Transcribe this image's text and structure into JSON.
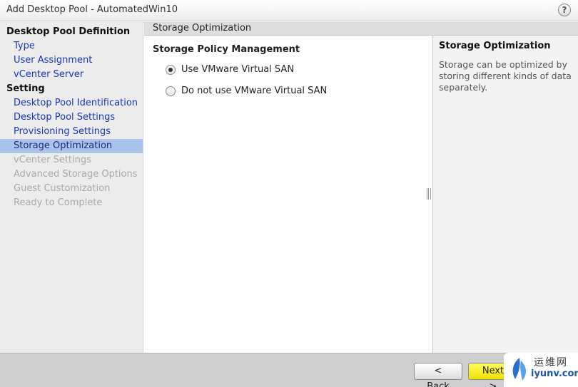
{
  "window": {
    "title": "Add Desktop Pool - AutomatedWin10",
    "help_label": "?"
  },
  "nav": {
    "definition_group": "Desktop Pool Definition",
    "definition_items": [
      {
        "label": "Type",
        "state": "link"
      },
      {
        "label": "User Assignment",
        "state": "link"
      },
      {
        "label": "vCenter Server",
        "state": "link"
      }
    ],
    "setting_group": "Setting",
    "setting_items": [
      {
        "label": "Desktop Pool Identification",
        "state": "link"
      },
      {
        "label": "Desktop Pool Settings",
        "state": "link"
      },
      {
        "label": "Provisioning Settings",
        "state": "link"
      },
      {
        "label": "Storage Optimization",
        "state": "active"
      },
      {
        "label": "vCenter Settings",
        "state": "disabled"
      },
      {
        "label": "Advanced Storage Options",
        "state": "disabled"
      },
      {
        "label": "Guest Customization",
        "state": "disabled"
      },
      {
        "label": "Ready to Complete",
        "state": "disabled"
      }
    ]
  },
  "main": {
    "header": "Storage Optimization",
    "section_title": "Storage Policy Management",
    "options": [
      {
        "label": "Use VMware Virtual SAN",
        "checked": true
      },
      {
        "label": "Do not use VMware Virtual SAN",
        "checked": false
      }
    ]
  },
  "help_panel": {
    "title": "Storage Optimization",
    "text": "Storage can be optimized by storing different kinds of data separately."
  },
  "footer": {
    "back_label": "< Back",
    "next_label": "Next >"
  },
  "watermark": {
    "cn": "运维网",
    "en": "iyunv.com"
  },
  "colors": {
    "link": "#1a35b8",
    "active_bg": "#a9c3ea",
    "disabled": "#a8a8a8",
    "next_button": "#f0e000"
  }
}
